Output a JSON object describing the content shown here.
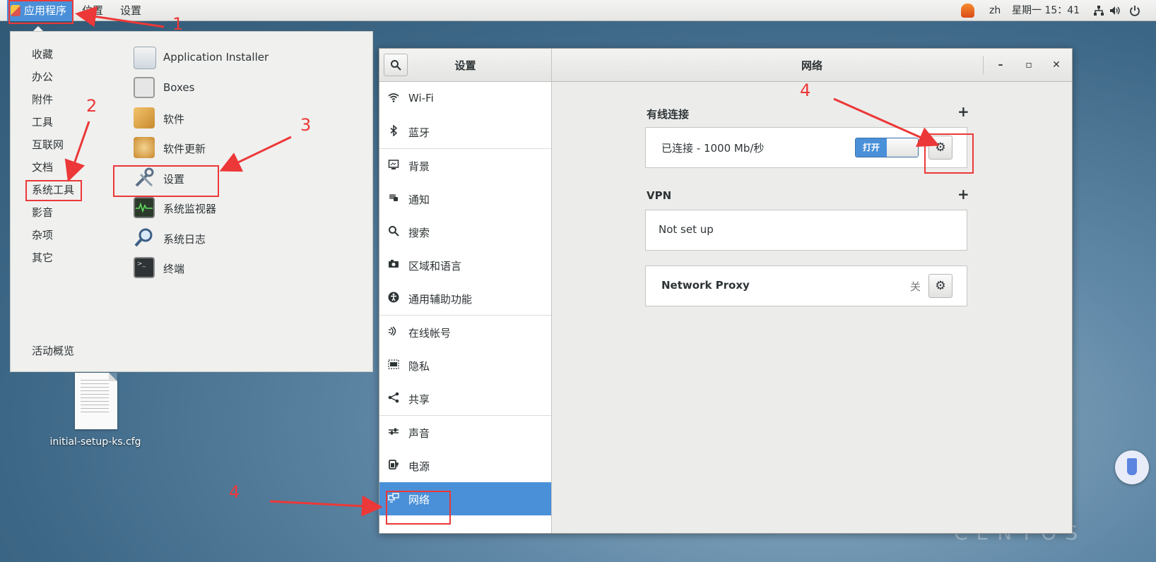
{
  "topbar": {
    "applications": "应用程序",
    "places": "位置",
    "settings": "设置",
    "lang": "zh",
    "clock": "星期一 15：41"
  },
  "app_menu": {
    "categories": [
      "收藏",
      "办公",
      "附件",
      "工具",
      "互联网",
      "文档",
      "系统工具",
      "影音",
      "杂项",
      "其它"
    ],
    "overview": "活动概览",
    "apps": [
      "Application Installer",
      "Boxes",
      "软件",
      "软件更新",
      "设置",
      "系统监视器",
      "系统日志",
      "终端"
    ]
  },
  "desktop": {
    "file_label": "initial-setup-ks.cfg",
    "watermark": "CENTOS"
  },
  "settings_window": {
    "sidebar_title": "设置",
    "page_title": "网络",
    "sidebar": [
      {
        "label": "Wi-Fi",
        "icon": "wifi-icon"
      },
      {
        "label": "蓝牙",
        "icon": "bluetooth-icon"
      },
      {
        "label": "背景",
        "icon": "background-icon"
      },
      {
        "label": "通知",
        "icon": "notification-icon"
      },
      {
        "label": "搜索",
        "icon": "search-icon"
      },
      {
        "label": "区域和语言",
        "icon": "region-icon"
      },
      {
        "label": "通用辅助功能",
        "icon": "accessibility-icon"
      },
      {
        "label": "在线帐号",
        "icon": "online-accounts-icon"
      },
      {
        "label": "隐私",
        "icon": "privacy-icon"
      },
      {
        "label": "共享",
        "icon": "share-icon"
      },
      {
        "label": "声音",
        "icon": "sound-icon"
      },
      {
        "label": "电源",
        "icon": "power-icon"
      },
      {
        "label": "网络",
        "icon": "network-icon"
      }
    ],
    "wired": {
      "title": "有线连接",
      "status": "已连接 - 1000 Mb/秒",
      "toggle_label": "打开"
    },
    "vpn": {
      "title": "VPN",
      "status": "Not set up"
    },
    "proxy": {
      "label": "Network Proxy",
      "state": "关"
    }
  },
  "annotations": {
    "steps": [
      "1",
      "2",
      "3",
      "4",
      "4"
    ]
  },
  "colors": {
    "accent": "#4a90d9",
    "annotation": "#ec3838"
  }
}
